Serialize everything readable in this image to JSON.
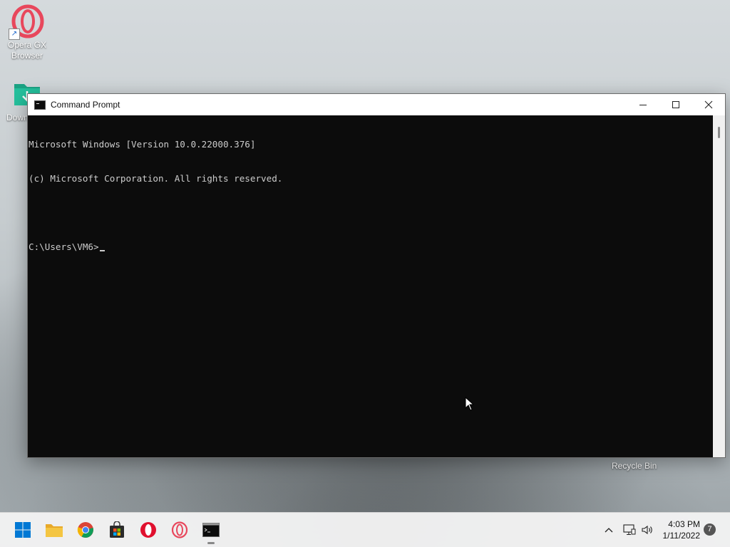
{
  "desktop": {
    "icons": [
      {
        "label": "Opera GX Browser",
        "icon": "opera-gx-icon"
      },
      {
        "label": "Down",
        "icon": "downloads-folder-icon"
      }
    ],
    "recycle_bin_label": "Recycle Bin"
  },
  "window": {
    "title": "Command Prompt",
    "icon": "cmd-icon",
    "controls": {
      "minimize": "─",
      "maximize": "☐",
      "close": "✕"
    },
    "console_lines": [
      "Microsoft Windows [Version 10.0.22000.376]",
      "(c) Microsoft Corporation. All rights reserved.",
      "",
      "C:\\Users\\VM6>"
    ],
    "background_color": "#0c0c0c",
    "text_color": "#cccccc"
  },
  "taskbar": {
    "apps": [
      {
        "name": "start",
        "icon": "windows-start-icon",
        "color": "#0078d4"
      },
      {
        "name": "file-explorer",
        "icon": "folder-icon",
        "color": "#f4c542"
      },
      {
        "name": "chrome",
        "icon": "chrome-icon"
      },
      {
        "name": "microsoft-store",
        "icon": "store-icon"
      },
      {
        "name": "opera",
        "icon": "opera-icon",
        "color": "#e0102e"
      },
      {
        "name": "opera-gx",
        "icon": "opera-gx-icon",
        "color": "#e8475c"
      },
      {
        "name": "command-prompt",
        "icon": "cmd-icon",
        "active": true
      }
    ],
    "tray": {
      "chevron": "chevron-up-icon",
      "network": "network-icon",
      "volume": "volume-icon"
    },
    "clock": {
      "time": "4:03 PM",
      "date": "1/11/2022"
    },
    "notification_count": "7"
  }
}
